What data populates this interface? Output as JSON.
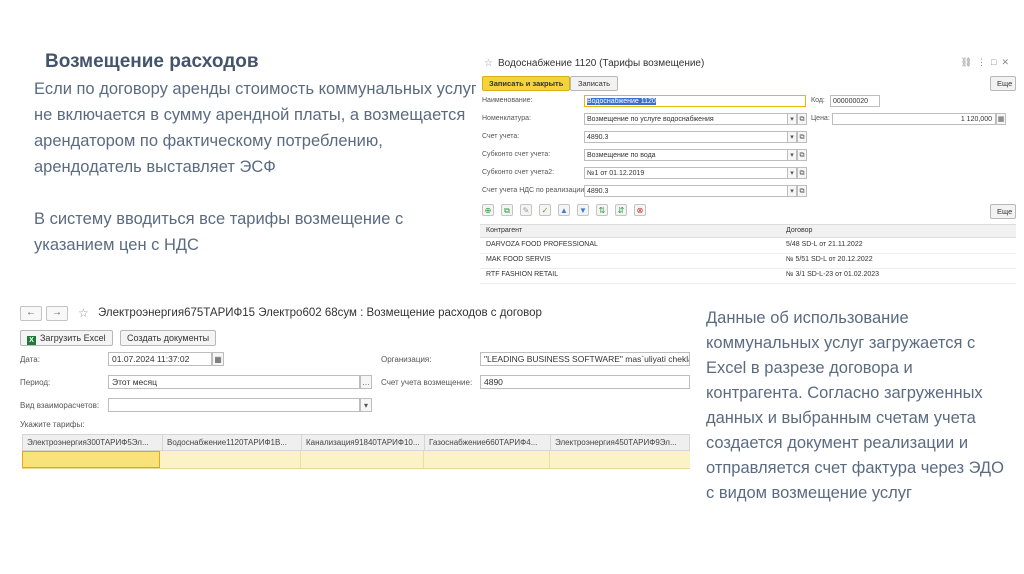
{
  "slide": {
    "title": "Возмещение расходов",
    "left_paragraphs": [
      "Если по договору аренды стоимость коммунальных услуг не включается в сумму арендной платы, а возмещается арендатором по фактическому потреблению, арендодатель выставляет ЭСФ",
      "В систему вводиться все тарифы возмещение с указанием цен с НДС"
    ],
    "right_text": "Данные об использование коммунальных услуг загружается с Excel в разрезе договора и контрагента. Согласно загруженных данных и выбранным счетам учета создается документ реализации и отправляется счет фактура через ЭДО с видом возмещение услуг"
  },
  "tariff_window": {
    "title": "Водоснабжение 1120 (Тарифы возмещение)",
    "save_close_label": "Записать и закрыть",
    "save_label": "Записать",
    "more_label": "Еще",
    "name_label": "Наименование:",
    "name_value": "Водоснабжение 1120",
    "code_label": "Код:",
    "code_value": "000000020",
    "nomenclature_label": "Номенклатура:",
    "nomenclature_value": "Возмещение по услуге водоснабжения",
    "price_label": "Цена:",
    "price_value": "1 120,000",
    "account_label": "Счет учета:",
    "account_value": "4890.3",
    "subconto1_label": "Субконто счет учета:",
    "subconto1_value": "Возмещение по вода",
    "subconto2_label": "Субконто счет учета2:",
    "subconto2_value": "№1 от 01.12.2019",
    "vat_account_label": "Счет учета НДС по реализации:",
    "vat_account_value": "4890.3",
    "table_more_label": "Еще",
    "table_headers": [
      "Контрагент",
      "Договор"
    ],
    "table_rows": [
      [
        "DARVOZA FOOD PROFESSIONAL",
        "5/48 SD-L от 21.11.2022"
      ],
      [
        "MAK FOOD SERVIS",
        "№ 5/51 SD-L от 20.12.2022"
      ],
      [
        "RTF FASHION RETAIL",
        "№ 3/1 SD-L-23 от 01.02.2023"
      ]
    ]
  },
  "expense_window": {
    "title": "Электроэнергия675ТАРИФ15 Электро602 68сум : Возмещение расходов с договор",
    "load_excel_label": "Загрузить Excel",
    "create_docs_label": "Создать документы",
    "date_label": "Дата:",
    "date_value": "01.07.2024 11:37:02",
    "period_label": "Период:",
    "period_value": "Этот месяц",
    "settlement_label": "Вид взаиморасчетов:",
    "settlement_value": "",
    "org_label": "Организация:",
    "org_value": "\"LEADING BUSINESS SOFTWARE\" mas`uliyati chekla",
    "reimb_account_label": "Счет учета возмещение:",
    "reimb_account_value": "4890",
    "tariffs_label": "Укажите тарифы:",
    "tariff_columns": [
      "Электроэнергия300ТАРИФ5Эл...",
      "Водоснабжение1120ТАРИФ1В...",
      "Канализация91840ТАРИФ10...",
      "Газоснабжение660ТАРИФ4...",
      "Электроэнергия450ТАРИФ9Эл..."
    ]
  }
}
